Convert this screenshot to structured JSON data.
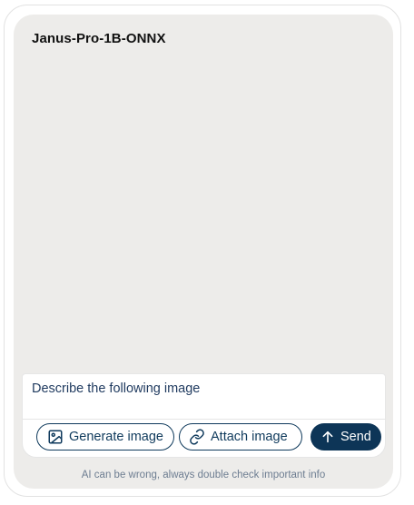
{
  "header": {
    "model_name": "Janus-Pro-1B-ONNX"
  },
  "composer": {
    "input_value": "Describe the following image",
    "buttons": {
      "generate_label": "Generate image",
      "attach_label": "Attach image",
      "send_label": "Send"
    }
  },
  "footer": {
    "disclaimer": "AI can be wrong, always double check important info"
  },
  "colors": {
    "panel_bg": "#edecea",
    "accent": "#0d3557",
    "text_primary": "#111111",
    "disclaimer": "#6d7d91"
  },
  "icons": {
    "generate": "image-icon",
    "attach": "link-icon",
    "send": "arrow-up-icon"
  }
}
